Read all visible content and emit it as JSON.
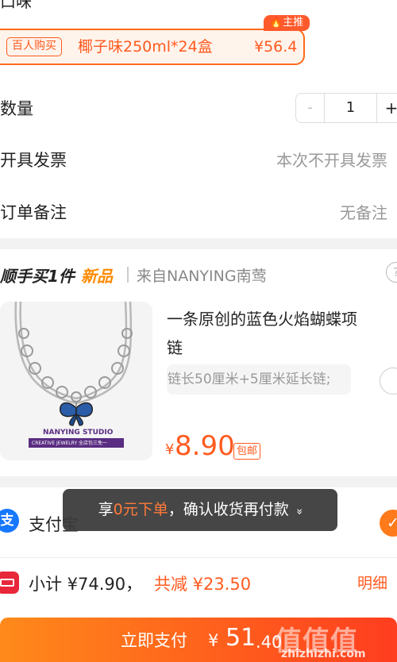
{
  "header": {
    "cut_text": "口味"
  },
  "flavor": {
    "tag": "百人购买",
    "name": "椰子味250ml*24盒",
    "price": "¥56.4",
    "badge": "主推",
    "badge_icon": "flame-icon"
  },
  "quantity": {
    "label": "数量",
    "minus": "-",
    "value": "1",
    "plus": "+"
  },
  "invoice": {
    "label": "开具发票",
    "value": "本次不开具发票"
  },
  "remark": {
    "label": "订单备注",
    "value": "无备注"
  },
  "addon": {
    "title": "顺手买1件",
    "new": "新品",
    "from": "来自NANYING南莺",
    "help": "?",
    "product": {
      "title": "一条原创的蓝色火焰蝴蝶项链",
      "spec": "链长50厘米+5厘米延长链;",
      "currency": "¥",
      "price": "8.90",
      "free_ship": "包邮",
      "image_brand": "NANYING STUDIO",
      "image_tagline": "CREATIVE JEWELRY  全店包三免一"
    }
  },
  "payment": {
    "icon_text": "支",
    "label": "支付宝",
    "check": "✓"
  },
  "toast": {
    "prefix": "享",
    "highlight": "0元下单",
    "suffix": "，确认收货再付款",
    "chevron": "»"
  },
  "summary": {
    "subtotal": "小计 ¥74.90，",
    "reduce": "共减 ¥23.50",
    "detail": "明细"
  },
  "submit": {
    "label": "立即支付",
    "currency": "¥",
    "amount_int": "51",
    "amount_dec": ".40"
  },
  "watermark": {
    "logo": "值值值",
    "text": "zhizhizhi.com"
  },
  "colors": {
    "accent": "#ff5a1f",
    "alipay": "#1677ff",
    "red_icon": "#e8273b"
  }
}
